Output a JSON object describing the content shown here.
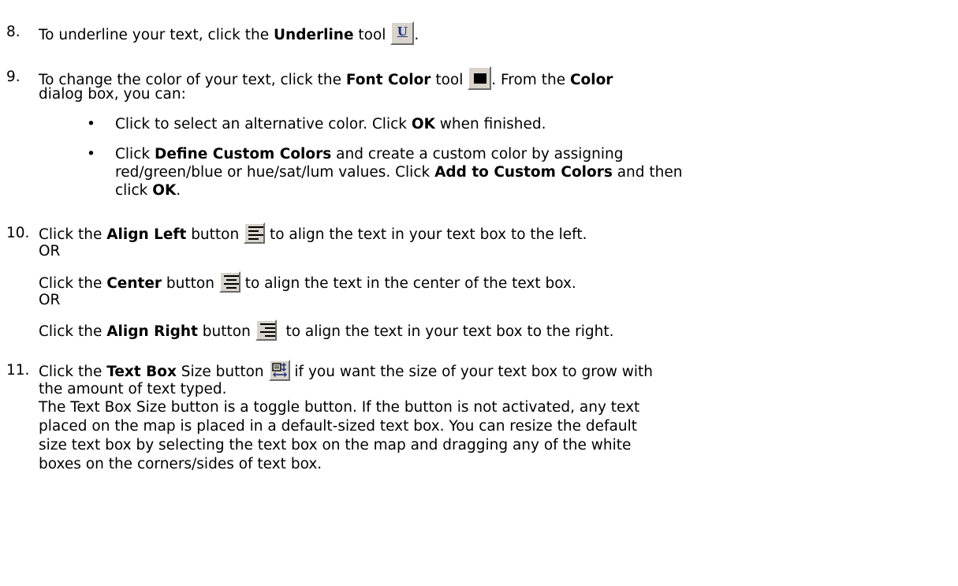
{
  "step8": {
    "number": "8.",
    "text_before": "To underline your text, click the ",
    "tool_name": "Underline",
    "text_mid": " tool ",
    "text_after": ".",
    "icon_glyph": "U"
  },
  "step9": {
    "number": "9.",
    "text_before": "To change the color of your text, click the ",
    "tool_name": "Font Color",
    "text_mid": " tool ",
    "text_after": ". From the ",
    "dialog_name": "Color",
    "line2": "dialog box, you can:",
    "bullets": [
      {
        "a": "Click to select an alternative color. Click ",
        "b": "OK",
        "c": " when finished."
      },
      {
        "a": "Click ",
        "b": "Define Custom Colors",
        "c": " and create a custom color by assigning",
        "line2_a": "red/green/blue or hue/sat/lum values. Click ",
        "line2_b": "Add to Custom Colors",
        "line2_c": " and then",
        "line3_a": "click ",
        "line3_b": "OK",
        "line3_c": "."
      }
    ]
  },
  "step10": {
    "number": "10.",
    "left_a": "Click the ",
    "left_b": "Align Left",
    "left_c": " button ",
    "left_d": " to align the text in your text box to the left.",
    "or1": "OR",
    "center_a": "Click the ",
    "center_b": "Center",
    "center_c": " button ",
    "center_d": " to align the text in the center of the text box.",
    "or2": "OR",
    "right_a": "Click the ",
    "right_b": "Align Right",
    "right_c": " button ",
    "right_d": "  to align the text in your text box to the right."
  },
  "step11": {
    "number": "11.",
    "a": "Click the ",
    "b": "Text Box",
    "c": " Size button ",
    "d": " if you want the size of your text box to grow with",
    "line2": "the amount of text typed.",
    "para": [
      "The Text Box Size button is a toggle button. If the button is not activated, any text",
      "placed on the map is placed in a default-sized text box. You can resize the default",
      "size text box by selecting the text box on the map and dragging any of the white",
      "boxes on the corners/sides of text box."
    ]
  },
  "colors": {
    "text": "#000000",
    "button_face": "#d8d4cc",
    "underline_glyph": "#1f2f7a"
  }
}
